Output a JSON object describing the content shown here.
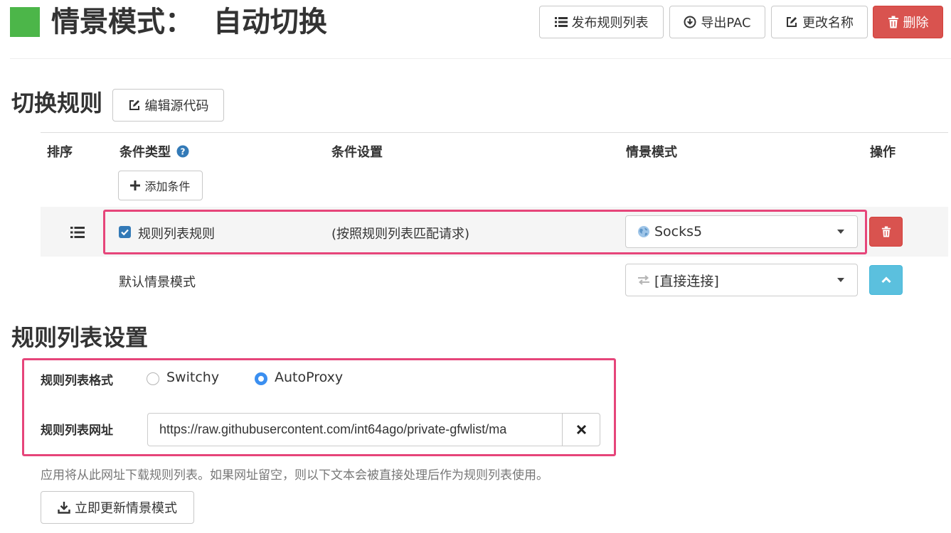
{
  "header": {
    "title": "情景模式：  自动切换",
    "accent_color": "#4cb649",
    "publish_label": "发布规则列表",
    "export_label": "导出PAC",
    "rename_label": "更改名称",
    "delete_label": "删除"
  },
  "switch_rules": {
    "heading": "切换规则",
    "edit_source_label": "编辑源代码",
    "columns": {
      "order": "排序",
      "condition_type": "条件类型",
      "condition_setting": "条件设置",
      "profile": "情景模式",
      "actions": "操作"
    },
    "add_condition_label": "添加条件",
    "rows": [
      {
        "condition_type": "规则列表规则",
        "checked": true,
        "condition_setting": "(按照规则列表匹配请求)",
        "profile": "Socks5"
      }
    ],
    "default_label": "默认情景模式",
    "default_profile": "[直接连接]"
  },
  "rule_list_settings": {
    "heading": "规则列表设置",
    "format_label": "规则列表格式",
    "format_options": [
      "Switchy",
      "AutoProxy"
    ],
    "format_selected": "AutoProxy",
    "url_label": "规则列表网址",
    "url_value": "https://raw.githubusercontent.com/int64ago/private-gfwlist/ma",
    "help_text": "应用将从此网址下载规则列表。如果网址留空，则以下文本会被直接处理后作为规则列表使用。",
    "update_label": "立即更新情景模式"
  },
  "colors": {
    "highlight": "#e6457a",
    "danger": "#d9534f",
    "info": "#5bc0de",
    "radio_selected": "#3b8ff0",
    "checkbox": "#337ab7"
  }
}
